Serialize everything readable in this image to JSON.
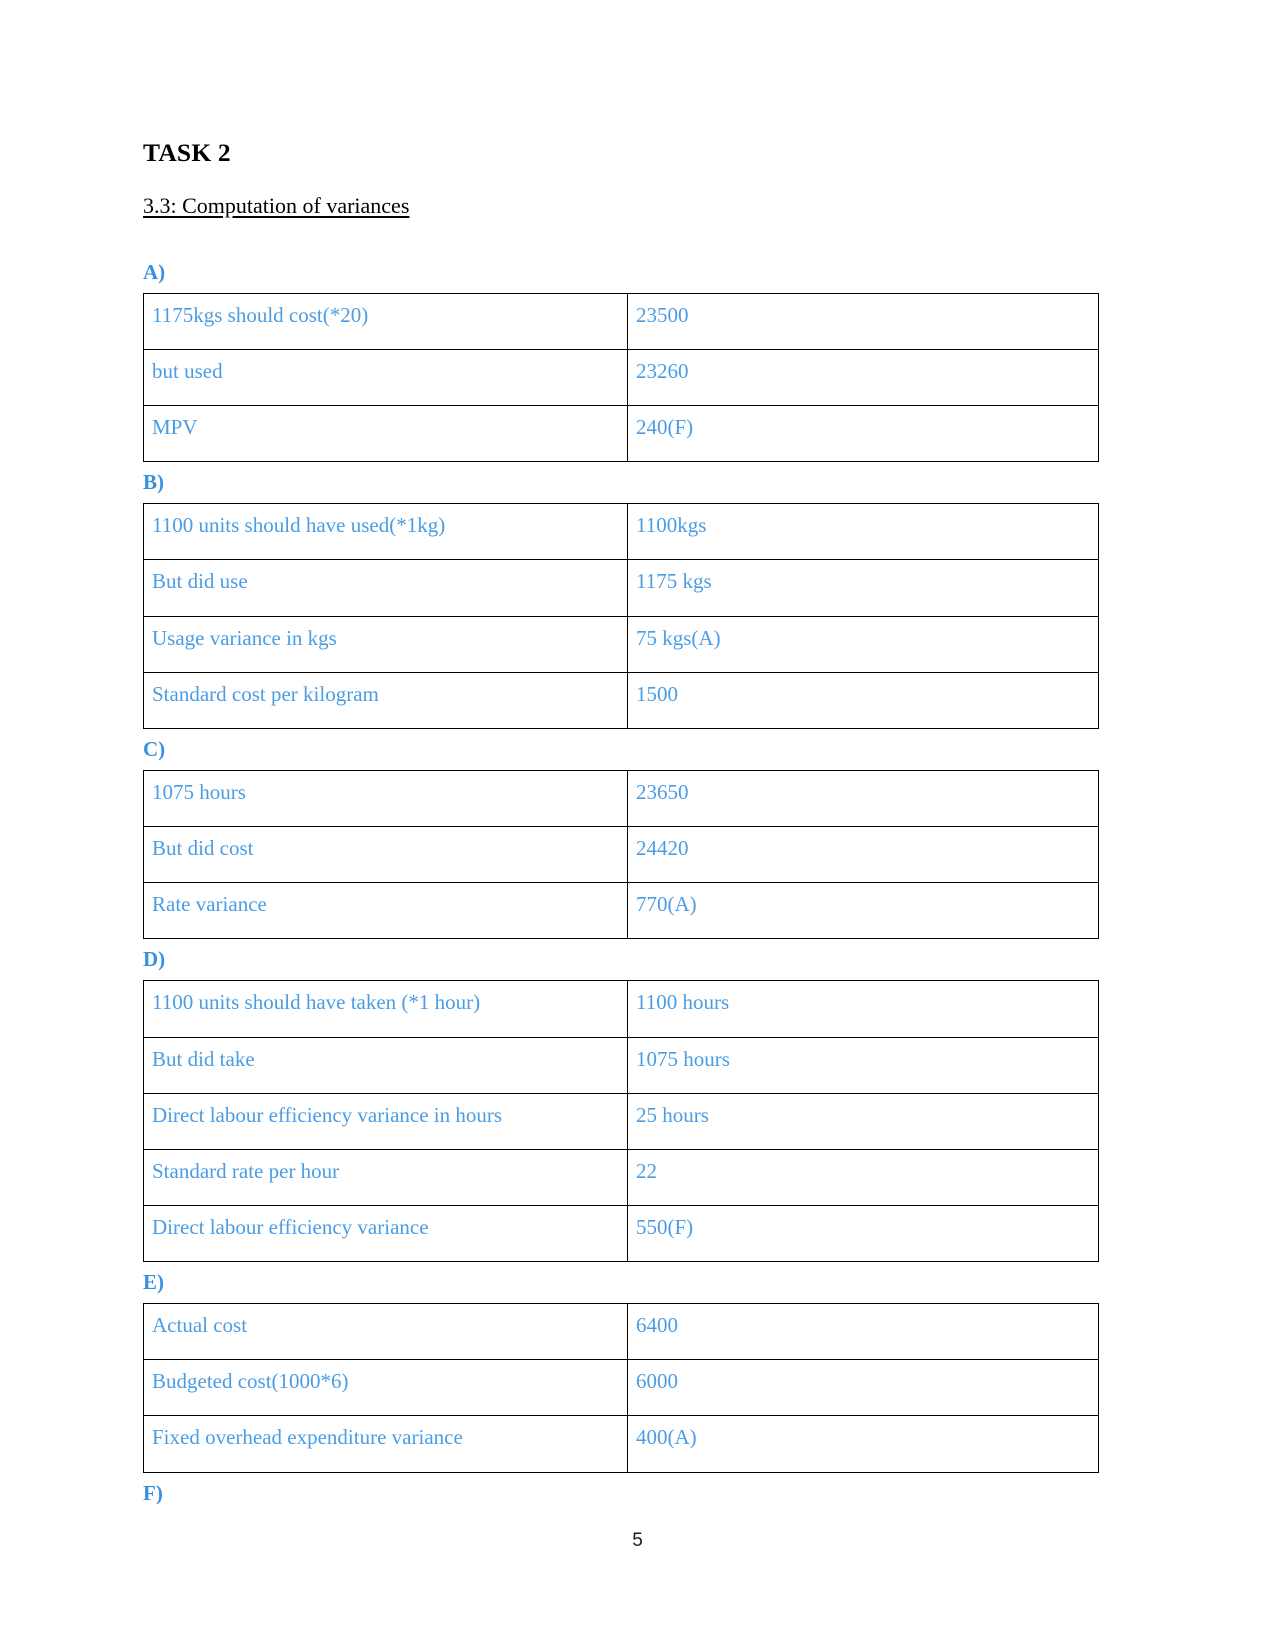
{
  "document": {
    "title": "TASK 2",
    "section_heading": "3.3: Computation of variances",
    "page_number": "5",
    "accent_color": "#4a9de4",
    "heading_color": "#000000"
  },
  "sections": [
    {
      "label": "A)",
      "rows": [
        {
          "label": "1175kgs should cost(*20)",
          "value": "23500"
        },
        {
          "label": "but used",
          "value": "23260"
        },
        {
          "label": "MPV",
          "value": "240(F)"
        }
      ]
    },
    {
      "label": "B)",
      "rows": [
        {
          "label": "1100 units should have used(*1kg)",
          "value": "1100kgs"
        },
        {
          "label": "But did use",
          "value": "1175 kgs"
        },
        {
          "label": "Usage variance in kgs",
          "value": "75 kgs(A)"
        },
        {
          "label": "Standard cost per kilogram",
          "value": "1500"
        }
      ]
    },
    {
      "label": "C)",
      "rows": [
        {
          "label": "1075 hours",
          "value": "23650"
        },
        {
          "label": "But did cost",
          "value": "24420"
        },
        {
          "label": "Rate variance",
          "value": "770(A)"
        }
      ]
    },
    {
      "label": "D)",
      "rows": [
        {
          "label": "1100 units should have taken (*1 hour)",
          "value": "1100 hours"
        },
        {
          "label": "But did take",
          "value": "1075 hours"
        },
        {
          "label": "Direct labour efficiency variance in hours",
          "value": "25 hours"
        },
        {
          "label": "Standard rate per hour",
          "value": "22"
        },
        {
          "label": "Direct labour efficiency variance",
          "value": "550(F)"
        }
      ]
    },
    {
      "label": "E)",
      "rows": [
        {
          "label": "Actual cost",
          "value": "6400"
        },
        {
          "label": "Budgeted cost(1000*6)",
          "value": "6000"
        },
        {
          "label": "Fixed overhead expenditure variance",
          "value": "400(A)"
        }
      ]
    },
    {
      "label": "F)",
      "rows": []
    }
  ]
}
